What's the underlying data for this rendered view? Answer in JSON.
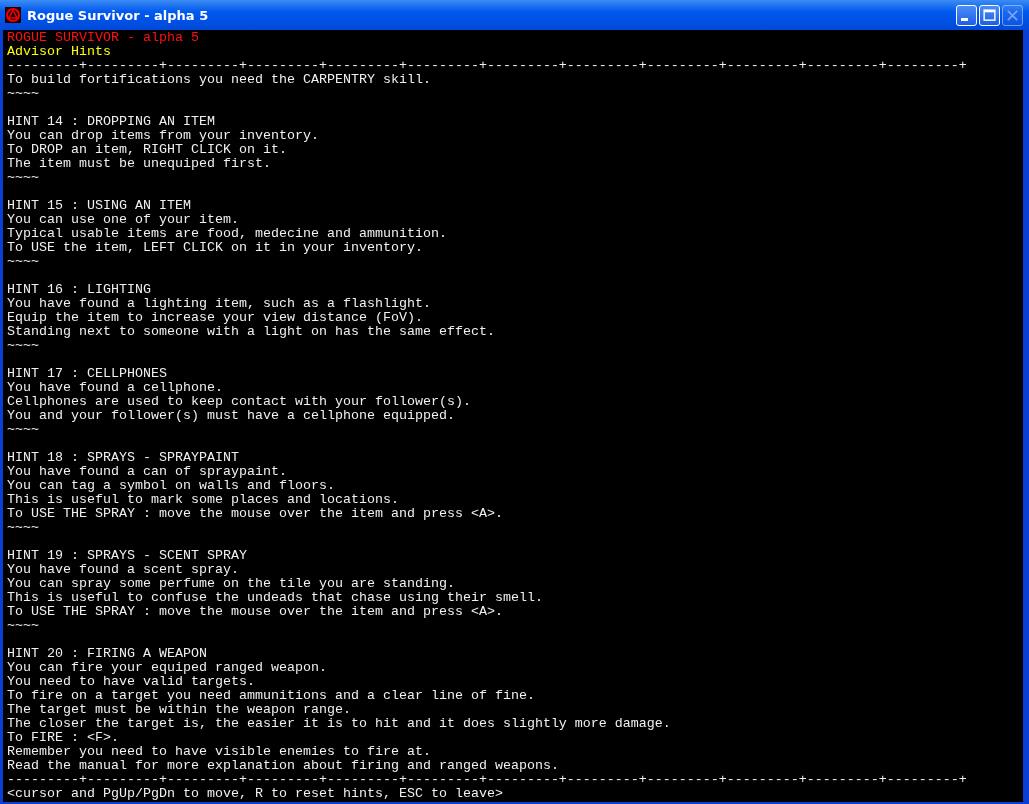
{
  "window": {
    "title": "Rogue Survivor - alpha 5",
    "buttons": [
      {
        "kind": "minimize",
        "disabled": false
      },
      {
        "kind": "maximize",
        "disabled": false
      },
      {
        "kind": "close",
        "disabled": true
      }
    ]
  },
  "header": {
    "game_title": "ROGUE SURVIVOR - alpha 5",
    "screen_title": "Advisor Hints"
  },
  "divider_top": "---------+---------+---------+---------+---------+---------+---------+---------+---------+---------+---------+---------+",
  "lead": {
    "lines": [
      "To build fortifications you need the CARPENTRY skill."
    ],
    "separator": "~~~~"
  },
  "hints": [
    {
      "heading": "HINT 14 : DROPPING AN ITEM",
      "lines": [
        "You can drop items from your inventory.",
        "To DROP an item, RIGHT CLICK on it.",
        "The item must be unequiped first."
      ],
      "separator": "~~~~"
    },
    {
      "heading": "HINT 15 : USING AN ITEM",
      "lines": [
        "You can use one of your item.",
        "Typical usable items are food, medecine and ammunition.",
        "To USE the item, LEFT CLICK on it in your inventory."
      ],
      "separator": "~~~~"
    },
    {
      "heading": "HINT 16 : LIGHTING",
      "lines": [
        "You have found a lighting item, such as a flashlight.",
        "Equip the item to increase your view distance (FoV).",
        "Standing next to someone with a light on has the same effect."
      ],
      "separator": "~~~~"
    },
    {
      "heading": "HINT 17 : CELLPHONES",
      "lines": [
        "You have found a cellphone.",
        "Cellphones are used to keep contact with your follower(s).",
        "You and your follower(s) must have a cellphone equipped."
      ],
      "separator": "~~~~"
    },
    {
      "heading": "HINT 18 : SPRAYS - SPRAYPAINT",
      "lines": [
        "You have found a can of spraypaint.",
        "You can tag a symbol on walls and floors.",
        "This is useful to mark some places and locations.",
        "To USE THE SPRAY : move the mouse over the item and press <A>."
      ],
      "separator": "~~~~"
    },
    {
      "heading": "HINT 19 : SPRAYS - SCENT SPRAY",
      "lines": [
        "You have found a scent spray.",
        "You can spray some perfume on the tile you are standing.",
        "This is useful to confuse the undeads that chase using their smell.",
        "To USE THE SPRAY : move the mouse over the item and press <A>."
      ],
      "separator": "~~~~"
    },
    {
      "heading": "HINT 20 : FIRING A WEAPON",
      "lines": [
        "You can fire your equiped ranged weapon.",
        "You need to have valid targets.",
        "To fire on a target you need ammunitions and a clear line of fine.",
        "The target must be within the weapon range.",
        "The closer the target is, the easier it is to hit and it does slightly more damage.",
        "To FIRE : <F>.",
        "Remember you need to have visible enemies to fire at.",
        "Read the manual for more explanation about firing and ranged weapons."
      ]
    }
  ],
  "divider_bottom": "---------+---------+---------+---------+---------+---------+---------+---------+---------+---------+---------+---------+",
  "help_line": "<cursor and PgUp/PgDn to move, R to reset hints, ESC to leave>"
}
